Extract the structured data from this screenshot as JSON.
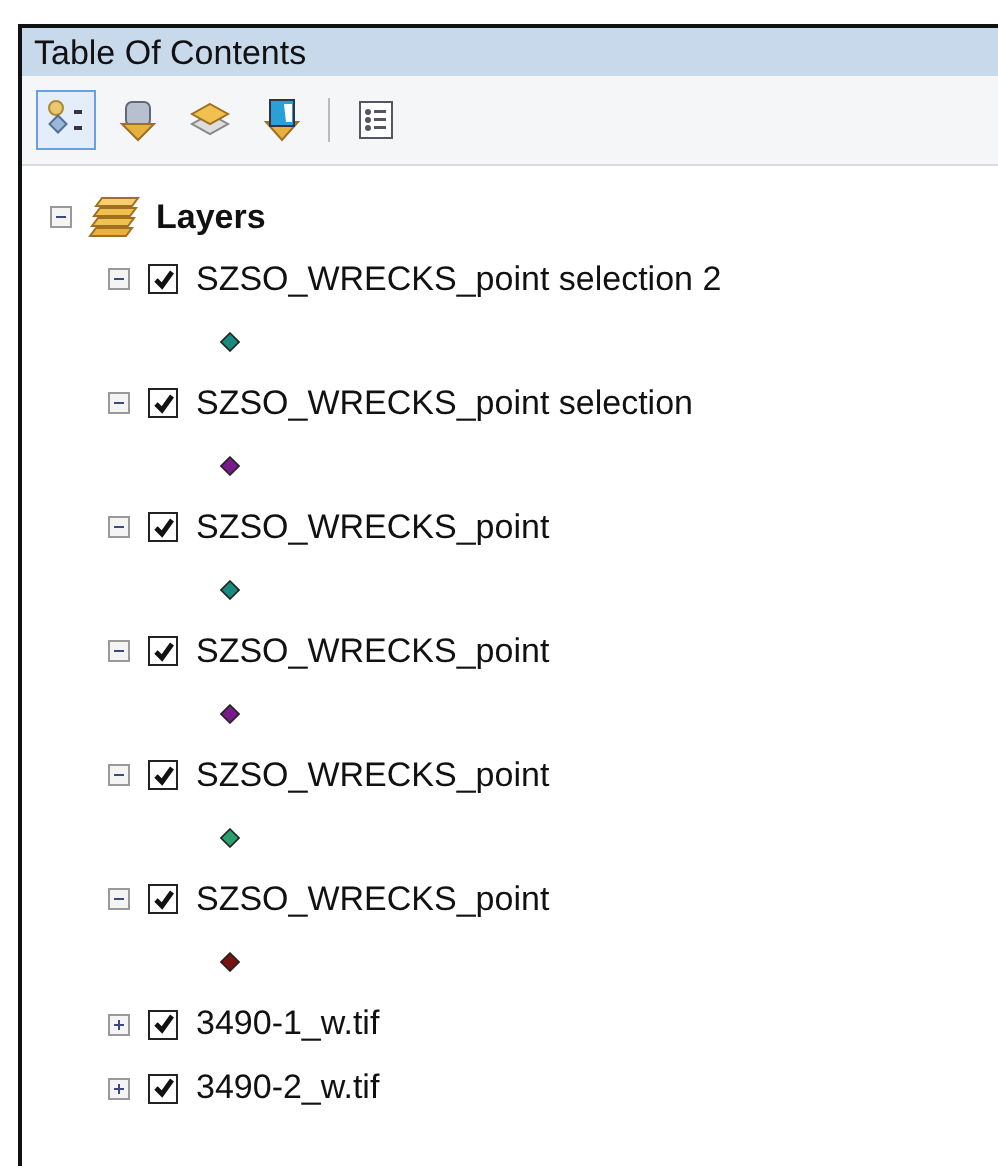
{
  "window": {
    "title": "Table Of Contents"
  },
  "toolbar": [
    {
      "kind": "list-by-drawing-order",
      "selected": true
    },
    {
      "kind": "list-by-source",
      "selected": false
    },
    {
      "kind": "list-by-visibility",
      "selected": false
    },
    {
      "kind": "list-by-selection",
      "selected": false
    },
    {
      "kind": "options",
      "selected": false
    }
  ],
  "tree": {
    "label": "Layers",
    "expanded": true,
    "children": [
      {
        "label": "SZSO_WRECKS_point selection 2",
        "checked": true,
        "expanded": true,
        "color": "#1a8a80"
      },
      {
        "label": "SZSO_WRECKS_point selection",
        "checked": true,
        "expanded": true,
        "color": "#7a1a8a"
      },
      {
        "label": "SZSO_WRECKS_point",
        "checked": true,
        "expanded": true,
        "color": "#1a8a80"
      },
      {
        "label": "SZSO_WRECKS_point",
        "checked": true,
        "expanded": true,
        "color": "#7a1a8a"
      },
      {
        "label": "SZSO_WRECKS_point",
        "checked": true,
        "expanded": true,
        "color": "#2aa070"
      },
      {
        "label": "SZSO_WRECKS_point",
        "checked": true,
        "expanded": true,
        "color": "#7a1010"
      },
      {
        "label": "3490-1_w.tif",
        "checked": true,
        "expanded": false
      },
      {
        "label": "3490-2_w.tif",
        "checked": true,
        "expanded": false
      }
    ]
  }
}
